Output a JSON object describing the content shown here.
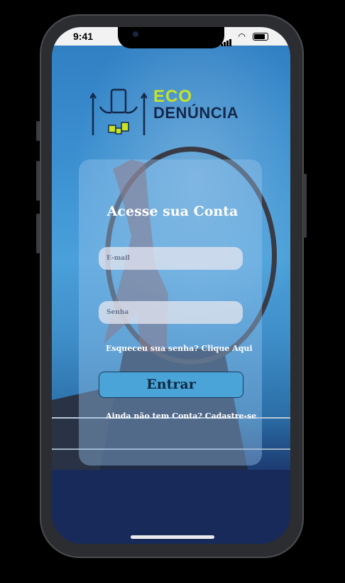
{
  "status_bar": {
    "time": "9:41"
  },
  "logo": {
    "line1": "ECO",
    "line2": "DENÚNCIA"
  },
  "login": {
    "title": "Acesse sua Conta",
    "email_placeholder": "E-mail",
    "password_placeholder": "Senha",
    "forgot_password": "Esqueceu sua senha? Clique Aqui",
    "submit_label": "Entrar",
    "signup_prompt": "Ainda não tem Conta? Cadastre-se"
  },
  "colors": {
    "logo_accent": "#c7e326",
    "logo_dark": "#14294b",
    "button": "#4aa4d8"
  },
  "icons": [
    "signal-icon",
    "wifi-icon",
    "battery-icon",
    "eco-denuncia-logo-icon"
  ]
}
